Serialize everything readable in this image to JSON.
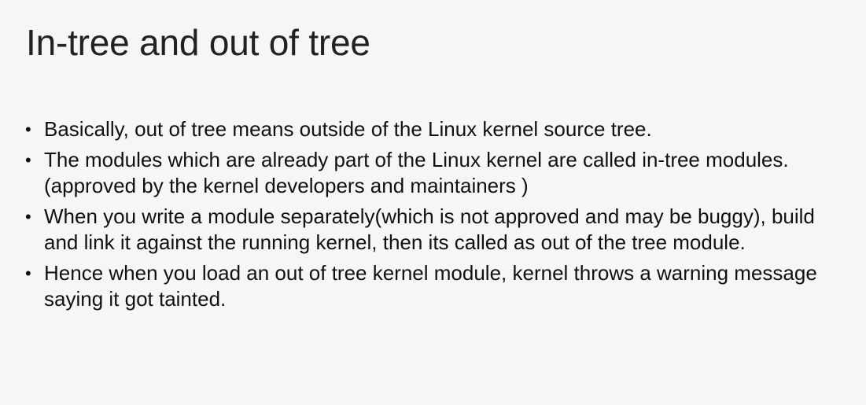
{
  "slide": {
    "title": "In-tree and out of tree",
    "bullet_symbol": "•",
    "bullets": [
      "Basically, out of tree means outside of the Linux kernel source tree.",
      "The modules which are already part of the Linux kernel are called in-tree modules. (approved by the kernel developers and maintainers )",
      "When you write a module separately(which is not approved and may be buggy), build and link it against the running kernel, then its called as out of the tree module.",
      "Hence when you load an out of tree kernel module, kernel throws a warning message saying it got tainted."
    ]
  }
}
